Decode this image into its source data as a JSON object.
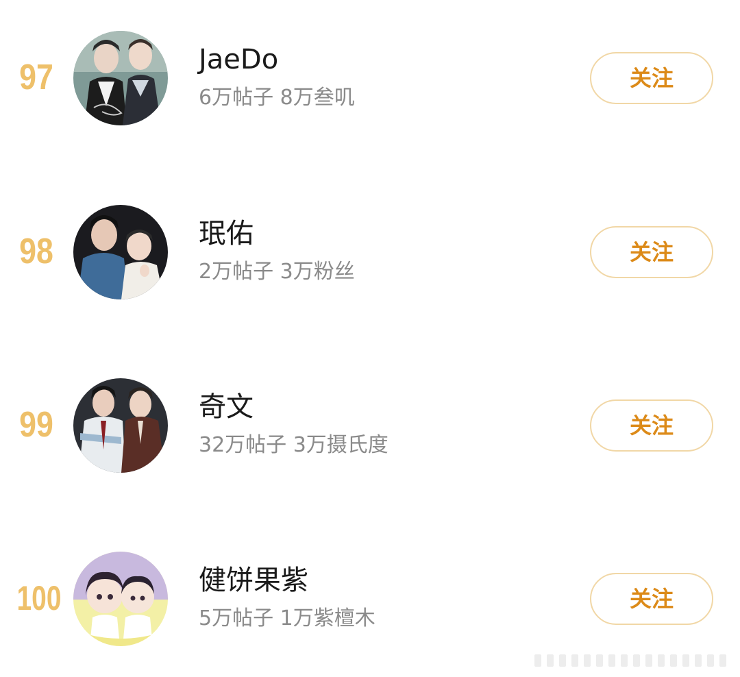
{
  "colors": {
    "rank": "#eec06a",
    "follow_text": "#dc8a18",
    "follow_border": "#f1d7a6"
  },
  "rows": [
    {
      "rank": "97",
      "name": "JaeDo",
      "stats": "6万帖子 8万叁叽",
      "follow_label": "关注"
    },
    {
      "rank": "98",
      "name": "珉佑",
      "stats": "2万帖子 3万粉丝",
      "follow_label": "关注"
    },
    {
      "rank": "99",
      "name": "奇文",
      "stats": "32万帖子 3万摄氏度",
      "follow_label": "关注"
    },
    {
      "rank": "100",
      "name": "健饼果紫",
      "stats": "5万帖子 1万紫檀木",
      "follow_label": "关注"
    }
  ]
}
